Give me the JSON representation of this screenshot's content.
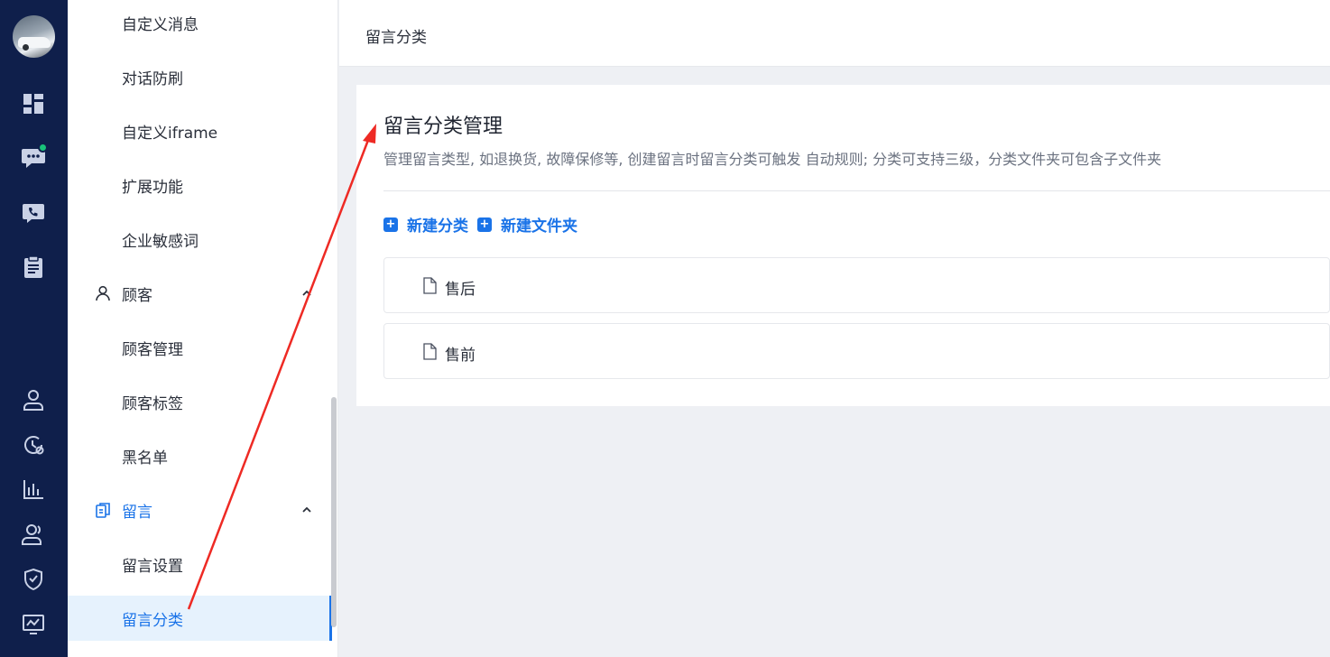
{
  "rail": {
    "icons": [
      "avatar",
      "dashboard-icon",
      "chat-icon",
      "phone-icon",
      "clipboard-icon",
      "user-icon",
      "history-icon",
      "bar-chart-icon",
      "team-icon",
      "shield-icon",
      "monitor-chart-icon"
    ],
    "online_dot_color": "#19c27a"
  },
  "submenu": {
    "items": [
      {
        "label": "自定义消息"
      },
      {
        "label": "对话防刷"
      },
      {
        "label": "自定义iframe"
      },
      {
        "label": "扩展功能"
      },
      {
        "label": "企业敏感词"
      },
      {
        "label": "顾客"
      },
      {
        "label": "顾客管理"
      },
      {
        "label": "顾客标签"
      },
      {
        "label": "黑名单"
      },
      {
        "label": "留言"
      },
      {
        "label": "留言设置"
      },
      {
        "label": "留言分类"
      }
    ]
  },
  "header": {
    "title": "留言分类"
  },
  "card": {
    "heading": "留言分类管理",
    "description": "管理留言类型, 如退换货, 故障保修等, 创建留言时留言分类可触发 自动规则; 分类可支持三级，分类文件夹可包含子文件夹",
    "actions": {
      "new_category": "新建分类",
      "new_folder": "新建文件夹"
    },
    "categories": [
      {
        "label": "售后"
      },
      {
        "label": "售前"
      }
    ]
  },
  "colors": {
    "accent": "#1a73e8",
    "rail_bg": "#0f1f4b",
    "annotation_arrow": "#ee2a24"
  }
}
